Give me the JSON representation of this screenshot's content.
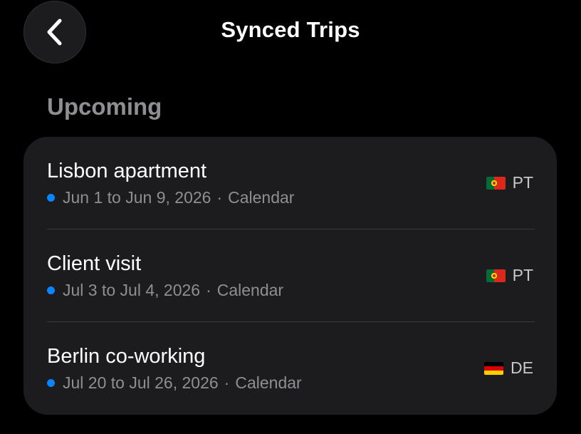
{
  "header": {
    "title": "Synced Trips",
    "back_icon": "chevron-left-icon"
  },
  "section": {
    "title": "Upcoming"
  },
  "trips": [
    {
      "name": "Lisbon apartment",
      "dates": "Jun 1 to Jun 9, 2026",
      "separator": "·",
      "source": "Calendar",
      "country_code": "PT",
      "flag_icon": "portugal-flag-icon"
    },
    {
      "name": "Client visit",
      "dates": "Jul 3 to Jul 4, 2026",
      "separator": "·",
      "source": "Calendar",
      "country_code": "PT",
      "flag_icon": "portugal-flag-icon"
    },
    {
      "name": "Berlin co-working",
      "dates": "Jul 20 to Jul 26, 2026",
      "separator": "·",
      "source": "Calendar",
      "country_code": "DE",
      "flag_icon": "germany-flag-icon"
    }
  ],
  "colors": {
    "background": "#000000",
    "card": "#1c1c1e",
    "secondary_text": "#8e8e93",
    "status_dot": "#0a84ff",
    "divider": "#3a3a3c"
  }
}
